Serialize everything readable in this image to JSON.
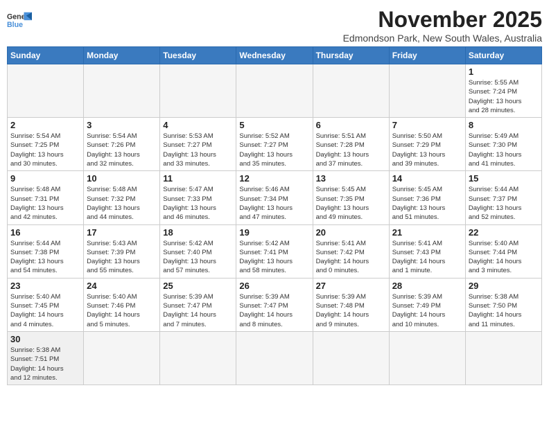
{
  "header": {
    "logo_line1": "General",
    "logo_line2": "Blue",
    "month": "November 2025",
    "location": "Edmondson Park, New South Wales, Australia"
  },
  "weekdays": [
    "Sunday",
    "Monday",
    "Tuesday",
    "Wednesday",
    "Thursday",
    "Friday",
    "Saturday"
  ],
  "weeks": [
    [
      {
        "day": "",
        "info": ""
      },
      {
        "day": "",
        "info": ""
      },
      {
        "day": "",
        "info": ""
      },
      {
        "day": "",
        "info": ""
      },
      {
        "day": "",
        "info": ""
      },
      {
        "day": "",
        "info": ""
      },
      {
        "day": "1",
        "info": "Sunrise: 5:55 AM\nSunset: 7:24 PM\nDaylight: 13 hours\nand 28 minutes."
      }
    ],
    [
      {
        "day": "2",
        "info": "Sunrise: 5:54 AM\nSunset: 7:25 PM\nDaylight: 13 hours\nand 30 minutes."
      },
      {
        "day": "3",
        "info": "Sunrise: 5:54 AM\nSunset: 7:26 PM\nDaylight: 13 hours\nand 32 minutes."
      },
      {
        "day": "4",
        "info": "Sunrise: 5:53 AM\nSunset: 7:27 PM\nDaylight: 13 hours\nand 33 minutes."
      },
      {
        "day": "5",
        "info": "Sunrise: 5:52 AM\nSunset: 7:27 PM\nDaylight: 13 hours\nand 35 minutes."
      },
      {
        "day": "6",
        "info": "Sunrise: 5:51 AM\nSunset: 7:28 PM\nDaylight: 13 hours\nand 37 minutes."
      },
      {
        "day": "7",
        "info": "Sunrise: 5:50 AM\nSunset: 7:29 PM\nDaylight: 13 hours\nand 39 minutes."
      },
      {
        "day": "8",
        "info": "Sunrise: 5:49 AM\nSunset: 7:30 PM\nDaylight: 13 hours\nand 41 minutes."
      }
    ],
    [
      {
        "day": "9",
        "info": "Sunrise: 5:48 AM\nSunset: 7:31 PM\nDaylight: 13 hours\nand 42 minutes."
      },
      {
        "day": "10",
        "info": "Sunrise: 5:48 AM\nSunset: 7:32 PM\nDaylight: 13 hours\nand 44 minutes."
      },
      {
        "day": "11",
        "info": "Sunrise: 5:47 AM\nSunset: 7:33 PM\nDaylight: 13 hours\nand 46 minutes."
      },
      {
        "day": "12",
        "info": "Sunrise: 5:46 AM\nSunset: 7:34 PM\nDaylight: 13 hours\nand 47 minutes."
      },
      {
        "day": "13",
        "info": "Sunrise: 5:45 AM\nSunset: 7:35 PM\nDaylight: 13 hours\nand 49 minutes."
      },
      {
        "day": "14",
        "info": "Sunrise: 5:45 AM\nSunset: 7:36 PM\nDaylight: 13 hours\nand 51 minutes."
      },
      {
        "day": "15",
        "info": "Sunrise: 5:44 AM\nSunset: 7:37 PM\nDaylight: 13 hours\nand 52 minutes."
      }
    ],
    [
      {
        "day": "16",
        "info": "Sunrise: 5:44 AM\nSunset: 7:38 PM\nDaylight: 13 hours\nand 54 minutes."
      },
      {
        "day": "17",
        "info": "Sunrise: 5:43 AM\nSunset: 7:39 PM\nDaylight: 13 hours\nand 55 minutes."
      },
      {
        "day": "18",
        "info": "Sunrise: 5:42 AM\nSunset: 7:40 PM\nDaylight: 13 hours\nand 57 minutes."
      },
      {
        "day": "19",
        "info": "Sunrise: 5:42 AM\nSunset: 7:41 PM\nDaylight: 13 hours\nand 58 minutes."
      },
      {
        "day": "20",
        "info": "Sunrise: 5:41 AM\nSunset: 7:42 PM\nDaylight: 14 hours\nand 0 minutes."
      },
      {
        "day": "21",
        "info": "Sunrise: 5:41 AM\nSunset: 7:43 PM\nDaylight: 14 hours\nand 1 minute."
      },
      {
        "day": "22",
        "info": "Sunrise: 5:40 AM\nSunset: 7:44 PM\nDaylight: 14 hours\nand 3 minutes."
      }
    ],
    [
      {
        "day": "23",
        "info": "Sunrise: 5:40 AM\nSunset: 7:45 PM\nDaylight: 14 hours\nand 4 minutes."
      },
      {
        "day": "24",
        "info": "Sunrise: 5:40 AM\nSunset: 7:46 PM\nDaylight: 14 hours\nand 5 minutes."
      },
      {
        "day": "25",
        "info": "Sunrise: 5:39 AM\nSunset: 7:47 PM\nDaylight: 14 hours\nand 7 minutes."
      },
      {
        "day": "26",
        "info": "Sunrise: 5:39 AM\nSunset: 7:47 PM\nDaylight: 14 hours\nand 8 minutes."
      },
      {
        "day": "27",
        "info": "Sunrise: 5:39 AM\nSunset: 7:48 PM\nDaylight: 14 hours\nand 9 minutes."
      },
      {
        "day": "28",
        "info": "Sunrise: 5:39 AM\nSunset: 7:49 PM\nDaylight: 14 hours\nand 10 minutes."
      },
      {
        "day": "29",
        "info": "Sunrise: 5:38 AM\nSunset: 7:50 PM\nDaylight: 14 hours\nand 11 minutes."
      }
    ],
    [
      {
        "day": "30",
        "info": "Sunrise: 5:38 AM\nSunset: 7:51 PM\nDaylight: 14 hours\nand 12 minutes."
      },
      {
        "day": "",
        "info": ""
      },
      {
        "day": "",
        "info": ""
      },
      {
        "day": "",
        "info": ""
      },
      {
        "day": "",
        "info": ""
      },
      {
        "day": "",
        "info": ""
      },
      {
        "day": "",
        "info": ""
      }
    ]
  ]
}
